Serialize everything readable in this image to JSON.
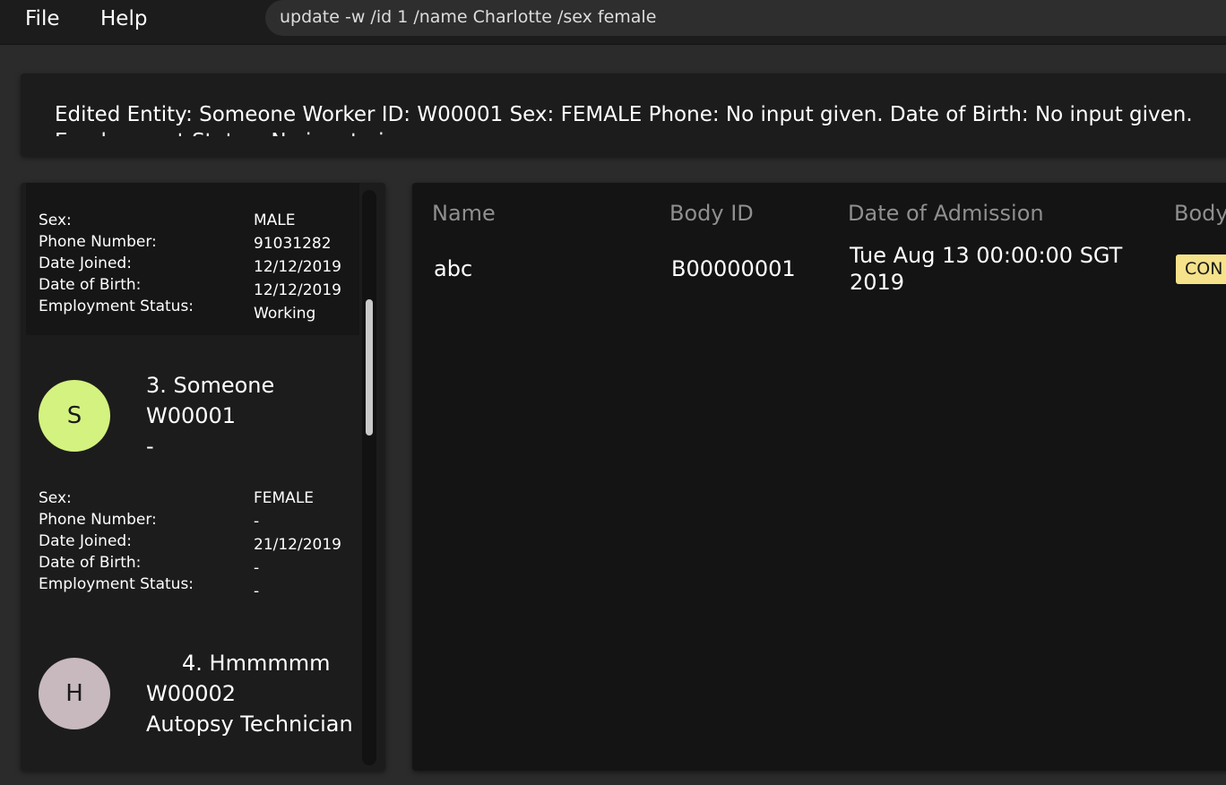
{
  "menu": {
    "file": "File",
    "help": "Help"
  },
  "command": {
    "text": "update -w /id 1 /name Charlotte /sex female"
  },
  "result": {
    "text": "Edited Entity: Someone Worker ID: W00001 Sex: FEMALE Phone: No input given. Date of Birth: No input given. Employment Status: No input given."
  },
  "worker_list": {
    "labels": {
      "sex": "Sex:",
      "phone": "Phone Number:",
      "joined": "Date Joined:",
      "dob": "Date of Birth:",
      "status": "Employment Status:"
    },
    "prev_details": {
      "sex": "MALE",
      "phone": "91031282",
      "joined": "12/12/2019",
      "dob": "12/12/2019",
      "status": "Working"
    },
    "cards": [
      {
        "initial": "S",
        "avatar_color": "#d4f27f",
        "name": "3. Someone",
        "id": "W00001",
        "designation": "-",
        "details": {
          "sex": "FEMALE",
          "phone": "-",
          "joined": "21/12/2019",
          "dob": "-",
          "status": "-"
        }
      },
      {
        "initial": "H",
        "avatar_color": "#c7b9be",
        "name": "4. Hmmmmm",
        "id": "W00002",
        "designation": "Autopsy Technician"
      }
    ]
  },
  "table": {
    "headers": {
      "name": "Name",
      "body_id": "Body ID",
      "admission": "Date of Admission",
      "status": "Body"
    },
    "rows": [
      {
        "name": "abc",
        "body_id": "B00000001",
        "admission": "Tue Aug 13 00:00:00 SGT 2019",
        "status": "CON"
      }
    ]
  },
  "colors": {
    "badge": "#f5e28a",
    "background": "#2b2b2b",
    "panel": "#1c1c1c"
  }
}
